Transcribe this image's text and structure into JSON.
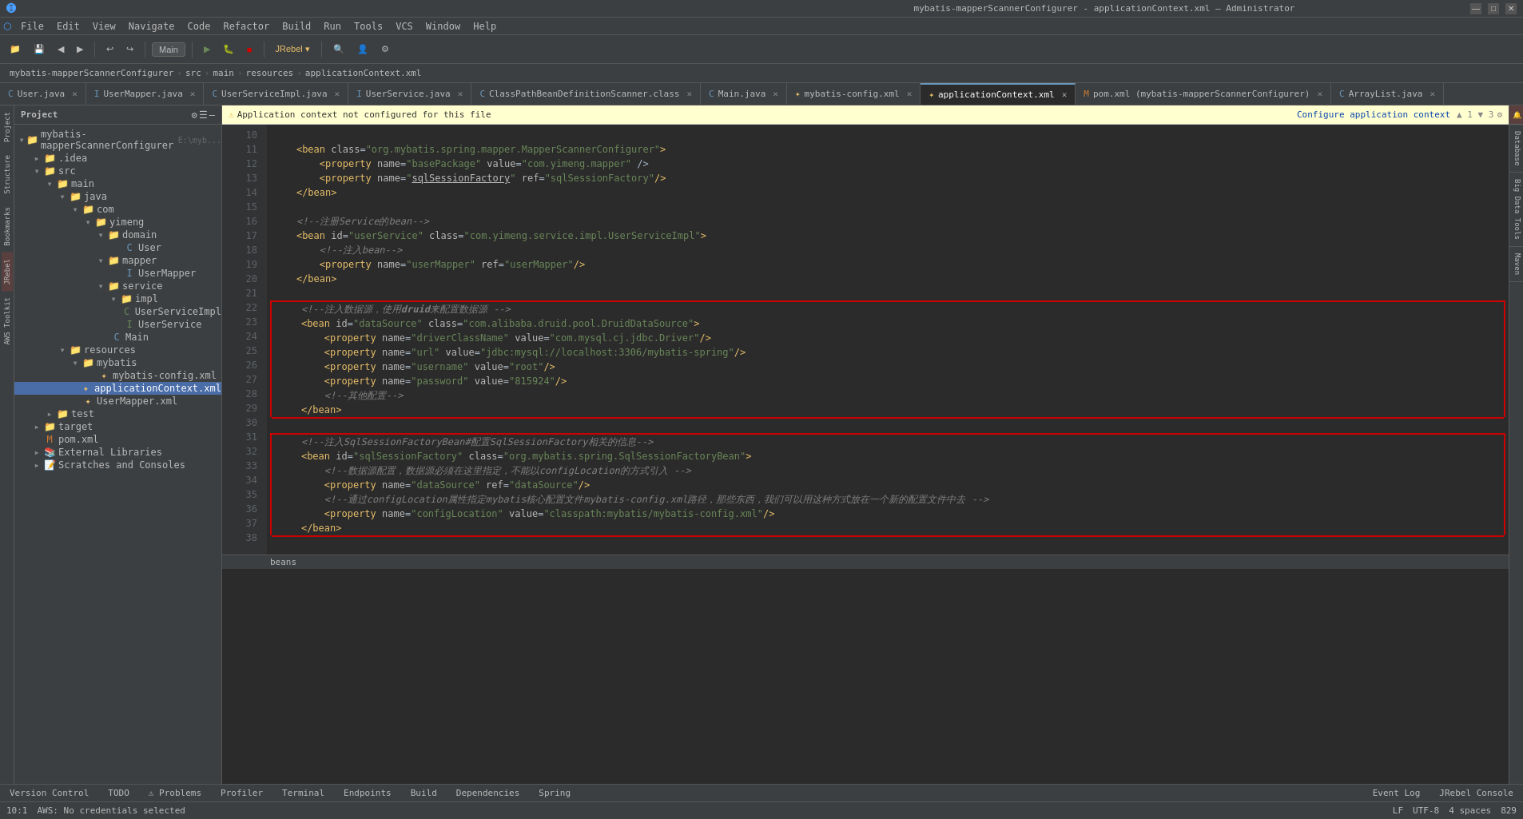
{
  "titleBar": {
    "title": "mybatis-mapperScannerConfigurer - applicationContext.xml – Administrator",
    "buttons": [
      "minimize",
      "maximize",
      "close"
    ]
  },
  "menuBar": {
    "items": [
      "File",
      "Edit",
      "View",
      "Navigate",
      "Code",
      "Refactor",
      "Build",
      "Run",
      "Tools",
      "VCS",
      "Window",
      "Help"
    ]
  },
  "toolbar": {
    "branch": "Main",
    "jrebel": "JRebel ▾"
  },
  "breadcrumb": {
    "parts": [
      "mybatis-mapperScannerConfigurer",
      "src",
      "main",
      "resources",
      "applicationContext.xml"
    ]
  },
  "editorTabs": [
    {
      "name": "User.java",
      "type": "java",
      "active": false
    },
    {
      "name": "UserMapper.java",
      "type": "java",
      "active": false
    },
    {
      "name": "UserServiceImpl.java",
      "type": "java",
      "active": false
    },
    {
      "name": "UserService.java",
      "type": "java",
      "active": false
    },
    {
      "name": "ClassPathBeanDefinitionScanner.class",
      "type": "class",
      "active": false
    },
    {
      "name": "Main.java",
      "type": "java",
      "active": false
    },
    {
      "name": "mybatis-config.xml",
      "type": "xml",
      "active": false
    },
    {
      "name": "applicationContext.xml",
      "type": "xml",
      "active": true
    },
    {
      "name": "pom.xml (mybatis-mapperScannerConfigurer)",
      "type": "xml",
      "active": false
    },
    {
      "name": "ArrayList.java",
      "type": "java",
      "active": false
    }
  ],
  "warningBar": {
    "text": "Application context not configured for this file",
    "linkText": "Configure application context"
  },
  "projectTree": {
    "title": "Project",
    "items": [
      {
        "label": "mybatis-mapperScannerConfigurer",
        "type": "project",
        "depth": 0,
        "expanded": true,
        "suffix": "E:\\myb..."
      },
      {
        "label": ".idea",
        "type": "folder",
        "depth": 1,
        "expanded": false
      },
      {
        "label": "src",
        "type": "folder",
        "depth": 1,
        "expanded": true
      },
      {
        "label": "main",
        "type": "folder",
        "depth": 2,
        "expanded": true
      },
      {
        "label": "java",
        "type": "folder",
        "depth": 3,
        "expanded": true
      },
      {
        "label": "com",
        "type": "folder",
        "depth": 4,
        "expanded": true
      },
      {
        "label": "yimeng",
        "type": "folder",
        "depth": 5,
        "expanded": true
      },
      {
        "label": "domain",
        "type": "folder",
        "depth": 6,
        "expanded": true
      },
      {
        "label": "User",
        "type": "java",
        "depth": 7,
        "expanded": false
      },
      {
        "label": "mapper",
        "type": "folder",
        "depth": 6,
        "expanded": true
      },
      {
        "label": "UserMapper",
        "type": "java",
        "depth": 7,
        "expanded": false
      },
      {
        "label": "service",
        "type": "folder",
        "depth": 6,
        "expanded": true
      },
      {
        "label": "impl",
        "type": "folder",
        "depth": 7,
        "expanded": true
      },
      {
        "label": "UserServiceImpl",
        "type": "java-green",
        "depth": 8,
        "expanded": false
      },
      {
        "label": "UserService",
        "type": "java-green",
        "depth": 7,
        "expanded": false
      },
      {
        "label": "Main",
        "type": "java",
        "depth": 6,
        "expanded": false
      },
      {
        "label": "resources",
        "type": "folder",
        "depth": 3,
        "expanded": true
      },
      {
        "label": "mybatis",
        "type": "folder",
        "depth": 4,
        "expanded": true
      },
      {
        "label": "mybatis-config.xml",
        "type": "xml",
        "depth": 5,
        "expanded": false
      },
      {
        "label": "applicationContext.xml",
        "type": "xml",
        "depth": 4,
        "expanded": false,
        "selected": true
      },
      {
        "label": "UserMapper.xml",
        "type": "xml",
        "depth": 4,
        "expanded": false
      },
      {
        "label": "test",
        "type": "folder",
        "depth": 2,
        "expanded": false
      },
      {
        "label": "target",
        "type": "folder",
        "depth": 1,
        "expanded": false
      },
      {
        "label": "pom.xml",
        "type": "xml",
        "depth": 1,
        "expanded": false
      },
      {
        "label": "External Libraries",
        "type": "folder",
        "depth": 1,
        "expanded": false
      },
      {
        "label": "Scratches and Consoles",
        "type": "folder",
        "depth": 1,
        "expanded": false
      }
    ]
  },
  "codeLines": [
    {
      "num": 10,
      "text": ""
    },
    {
      "num": 11,
      "text": "    <bean class=\"org.mybatis.spring.mapper.MapperScannerConfigurer\">",
      "type": "normal"
    },
    {
      "num": 12,
      "text": "        <property name=\"basePackage\" value=\"com.yimeng.mapper\" />",
      "type": "normal"
    },
    {
      "num": 13,
      "text": "        <property name=\"sqlSessionFactory\" ref=\"sqlSessionFactory\"/>",
      "type": "normal"
    },
    {
      "num": 14,
      "text": "    </bean>",
      "type": "normal"
    },
    {
      "num": 15,
      "text": ""
    },
    {
      "num": 16,
      "text": "    <!--注册Service的bean-->",
      "type": "comment"
    },
    {
      "num": 17,
      "text": "    <bean id=\"userService\" class=\"com.yimeng.service.impl.UserServiceImpl\">",
      "type": "normal"
    },
    {
      "num": 18,
      "text": "        <!--注入bean-->",
      "type": "comment"
    },
    {
      "num": 19,
      "text": "        <property name=\"userMapper\" ref=\"userMapper\"/>",
      "type": "normal"
    },
    {
      "num": 20,
      "text": "    </bean>",
      "type": "normal"
    },
    {
      "num": 21,
      "text": ""
    },
    {
      "num": 22,
      "text": "    <!--注入数据源，使用druid来配置数据源 -->",
      "type": "comment",
      "boxStart": true
    },
    {
      "num": 23,
      "text": "    <bean id=\"dataSource\" class=\"com.alibaba.druid.pool.DruidDataSource\">",
      "type": "normal"
    },
    {
      "num": 24,
      "text": "        <property name=\"driverClassName\" value=\"com.mysql.cj.jdbc.Driver\"/>",
      "type": "normal"
    },
    {
      "num": 25,
      "text": "        <property name=\"url\" value=\"jdbc:mysql://localhost:3306/mybatis-spring\"/>",
      "type": "normal"
    },
    {
      "num": 26,
      "text": "        <property name=\"username\" value=\"root\"/>",
      "type": "normal"
    },
    {
      "num": 27,
      "text": "        <property name=\"password\" value=\"815924\"/>",
      "type": "normal"
    },
    {
      "num": 28,
      "text": "        <!--其他配置-->",
      "type": "comment"
    },
    {
      "num": 29,
      "text": "    </bean>",
      "type": "normal",
      "boxEnd": true
    },
    {
      "num": 30,
      "text": ""
    },
    {
      "num": 31,
      "text": "    <!--注入SqlSessionFactoryBean#配置SqlSessionFactory相关的信息-->",
      "type": "comment",
      "boxStart2": true
    },
    {
      "num": 32,
      "text": "    <bean id=\"sqlSessionFactory\" class=\"org.mybatis.spring.SqlSessionFactoryBean\">",
      "type": "normal"
    },
    {
      "num": 33,
      "text": "        <!--数据源配置，数据源必须在这里指定，不能以configLocation的方式引入 -->",
      "type": "comment"
    },
    {
      "num": 34,
      "text": "        <property name=\"dataSource\" ref=\"dataSource\"/>",
      "type": "normal"
    },
    {
      "num": 35,
      "text": "        <!--通过configLocation属性指定mybatis核心配置文件mybatis-config.xml路径，那些东西，我们可以用这种方式放在一个新的配置文件中去 -->",
      "type": "comment"
    },
    {
      "num": 36,
      "text": "        <property name=\"configLocation\" value=\"classpath:mybatis/mybatis-config.xml\"/>",
      "type": "normal"
    },
    {
      "num": 37,
      "text": "    </bean>",
      "type": "normal",
      "boxEnd2": true
    },
    {
      "num": 38,
      "text": ""
    }
  ],
  "statusBar": {
    "left": [
      "Version Control",
      "TODO",
      "Problems",
      "Profiler",
      "Terminal",
      "Endpoints",
      "Build",
      "Dependencies",
      "Spring"
    ],
    "right": {
      "line": "10:1",
      "aws": "AWS: No credentials selected",
      "lf": "LF",
      "encoding": "UTF-8",
      "indent": "4 spaces",
      "extra": "829"
    }
  },
  "rightPanelTabs": [
    "Notifications",
    "Database",
    "Big Data Tools",
    "Maven"
  ],
  "bottomBarRight": [
    "Event Log",
    "JRebel Console"
  ],
  "warningCount": "1 ▲ 3",
  "scrollBottom": "beans"
}
